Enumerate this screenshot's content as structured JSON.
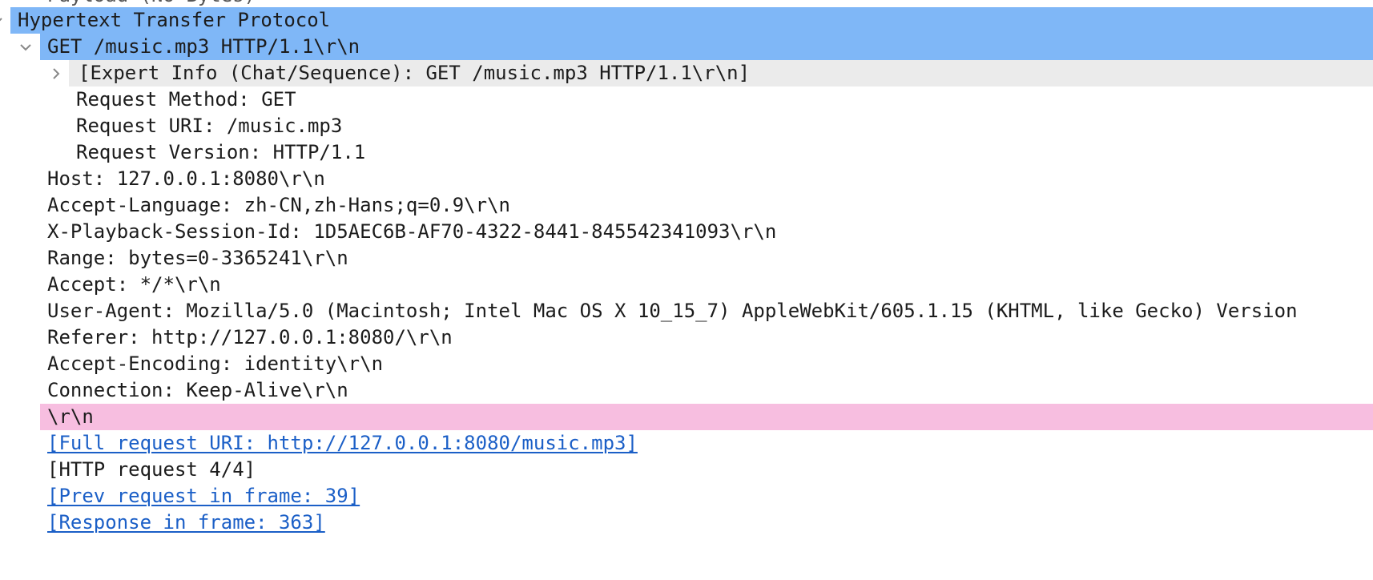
{
  "colors": {
    "selection_blue": "#7fb7f7",
    "expert_gray": "#ebebeb",
    "empty_line_pink": "#f7bee0",
    "link_blue": "#1b5fc7",
    "text": "#1c1c1c"
  },
  "tree": {
    "top_partial": "Payload (No Bytes)",
    "http_header": "Hypertext Transfer Protocol",
    "request_line": "GET /music.mp3 HTTP/1.1\\r\\n",
    "expert_info": "[Expert Info (Chat/Sequence): GET /music.mp3 HTTP/1.1\\r\\n]",
    "request_method": "Request Method: GET",
    "request_uri": "Request URI: /music.mp3",
    "request_version": "Request Version: HTTP/1.1",
    "host": "Host: 127.0.0.1:8080\\r\\n",
    "accept_language": "Accept-Language: zh-CN,zh-Hans;q=0.9\\r\\n",
    "playback_session": "X-Playback-Session-Id: 1D5AEC6B-AF70-4322-8441-845542341093\\r\\n",
    "range": "Range: bytes=0-3365241\\r\\n",
    "accept": "Accept: */*\\r\\n",
    "user_agent": "User-Agent: Mozilla/5.0 (Macintosh; Intel Mac OS X 10_15_7) AppleWebKit/605.1.15 (KHTML, like Gecko) Version",
    "referer": "Referer: http://127.0.0.1:8080/\\r\\n",
    "accept_encoding": "Accept-Encoding: identity\\r\\n",
    "connection": "Connection: Keep-Alive\\r\\n",
    "empty_line": "\\r\\n",
    "full_uri": "[Full request URI: http://127.0.0.1:8080/music.mp3]",
    "http_request": "[HTTP request 4/4]",
    "prev_request": "[Prev request in frame: 39]",
    "response_in": "[Response in frame: 363]"
  },
  "icons": {
    "http_expander": "chevron-down-icon",
    "request_line_expander": "chevron-down-icon",
    "expert_info_expander": "chevron-right-icon"
  }
}
